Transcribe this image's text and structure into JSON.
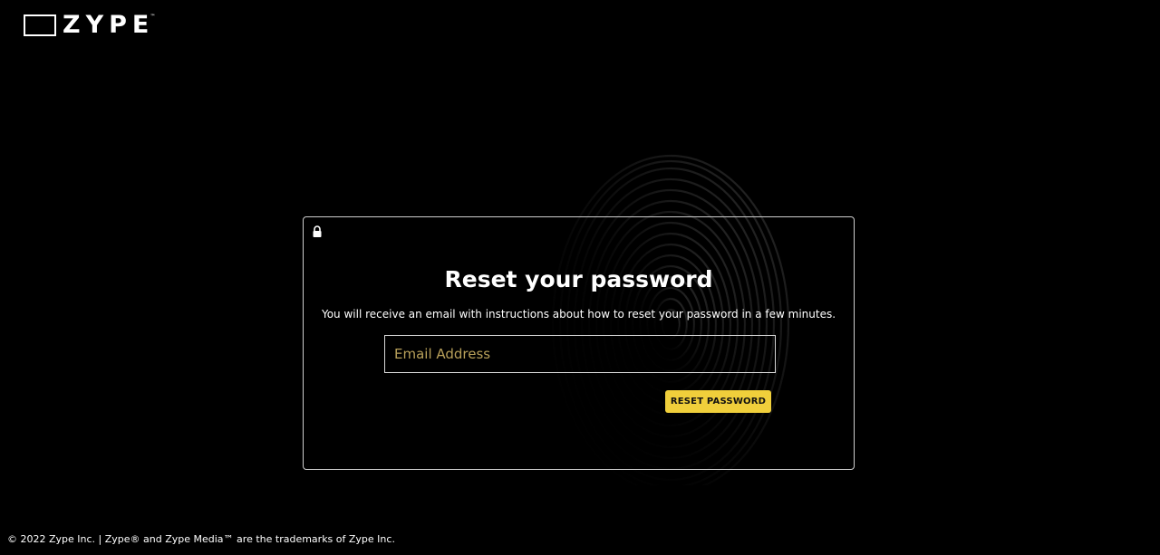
{
  "brand": {
    "name": "ZYPE",
    "tm": "™"
  },
  "card": {
    "lock_icon": "lock-icon",
    "title": "Reset your password",
    "subtitle": "You will receive an email with instructions about how to reset your password in a few minutes.",
    "email_input": {
      "value": "",
      "placeholder": "Email Address"
    },
    "reset_button_label": "RESET PASSWORD"
  },
  "footer": {
    "text": "© 2022 Zype Inc. | Zype® and Zype Media™ are the trademarks of Zype Inc."
  },
  "colors": {
    "background": "#000000",
    "accent": "#f0cf3b",
    "placeholder": "#b8a05a",
    "card_border": "#cfcfcf"
  }
}
